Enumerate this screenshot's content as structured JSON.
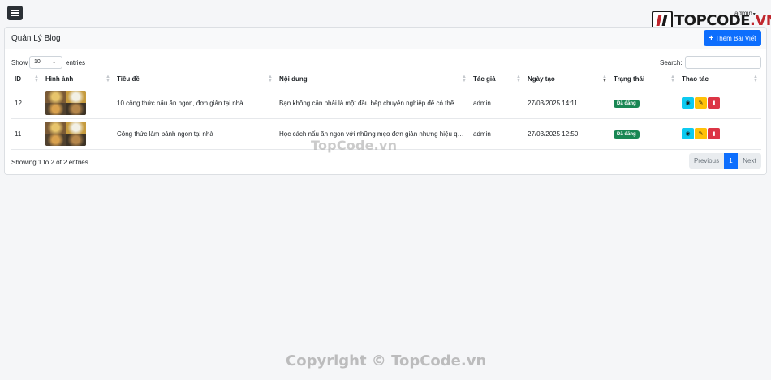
{
  "header": {
    "user_label": "admin",
    "logo_text_main": "TOPCODE",
    "logo_text_suffix": ".VN"
  },
  "card": {
    "title": "Quản Lý Blog",
    "add_button_label": "Thêm Bài Viết"
  },
  "controls": {
    "show_label": "Show",
    "page_length": "10",
    "entries_label": "entries",
    "search_label": "Search:",
    "search_value": ""
  },
  "table": {
    "columns": [
      "ID",
      "Hình ảnh",
      "Tiêu đề",
      "Nội dung",
      "Tác giả",
      "Ngày tạo",
      "Trạng thái",
      "Thao tác"
    ],
    "rows": [
      {
        "id": "12",
        "title": "10 công thức nấu ăn ngon, đơn giản tại nhà",
        "content": "Bạn không cần phải là một đầu bếp chuyên nghiệp để có thể n...",
        "author": "admin",
        "created": "27/03/2025 14:11",
        "status": "Đã đăng"
      },
      {
        "id": "11",
        "title": "Công thức làm bánh ngon tại nhà",
        "content": "Học cách nấu ăn ngon với những mẹo đơn giản nhưng hiệu qu...",
        "author": "admin",
        "created": "27/03/2025 12:50",
        "status": "Đã đăng"
      }
    ]
  },
  "footer": {
    "info": "Showing 1 to 2 of 2 entries",
    "prev_label": "Previous",
    "current_page": "1",
    "next_label": "Next"
  },
  "watermarks": {
    "middle": "TopCode.vn",
    "bottom": "Copyright © TopCode.vn"
  },
  "colors": {
    "primary": "#0d6efd",
    "success": "#198754",
    "info": "#0dcaf0",
    "warning": "#ffc107",
    "danger": "#dc3545"
  }
}
